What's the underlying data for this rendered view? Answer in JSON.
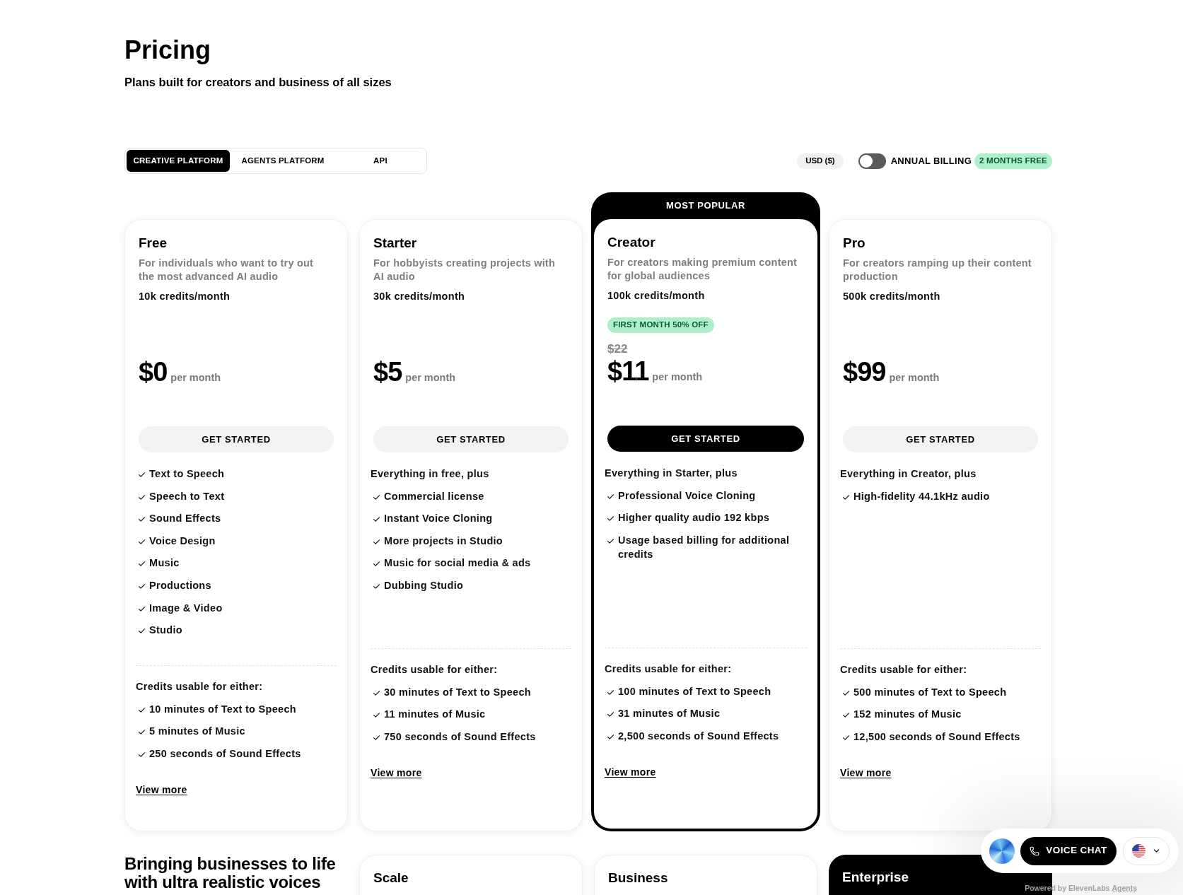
{
  "header": {
    "title": "Pricing",
    "subtitle": "Plans built for creators and business of all sizes"
  },
  "tabs": [
    {
      "label": "CREATIVE PLATFORM",
      "selected": true
    },
    {
      "label": "AGENTS PLATFORM",
      "selected": false
    },
    {
      "label": "API",
      "selected": false
    }
  ],
  "currency": "USD ($)",
  "billing": {
    "label": "ANNUAL BILLING",
    "on": false,
    "badge": "2 MONTHS FREE"
  },
  "plans": [
    {
      "name": "Free",
      "featured": false,
      "description": "For individuals who want to try out the most advanced AI audio",
      "credits": "10k credits/month",
      "price": "$0",
      "period": "per month",
      "cta": "GET STARTED",
      "features": [
        "Text to Speech",
        "Speech to Text",
        "Sound Effects",
        "Voice Design",
        "Music",
        "Productions",
        "Image & Video",
        "Studio"
      ],
      "credits_heading": "Credits usable for either:",
      "credit_uses": [
        "10 minutes of Text to Speech",
        "5 minutes of Music",
        "250 seconds of Sound Effects"
      ],
      "link": "View more"
    },
    {
      "name": "Starter",
      "featured": false,
      "description": "For hobbyists creating projects with AI audio",
      "credits": "30k credits/month",
      "price": "$5",
      "period": "per month",
      "cta": "GET STARTED",
      "features_intro": "Everything in free, plus",
      "features": [
        "Commercial license",
        "Instant Voice Cloning",
        "More projects in Studio",
        "Music for social media & ads",
        "Dubbing Studio"
      ],
      "credits_heading": "Credits usable for either:",
      "credit_uses": [
        "30 minutes of Text to Speech",
        "11 minutes of Music",
        "750 seconds of Sound Effects"
      ],
      "link": "View more"
    },
    {
      "name": "Creator",
      "featured": true,
      "ribbon": "MOST POPULAR",
      "description": "For creators making premium content for global audiences",
      "credits": "100k credits/month",
      "promo": "FIRST MONTH 50% OFF",
      "original_price": "$22",
      "price": "$11",
      "period": "per month",
      "cta": "GET STARTED",
      "features_intro": "Everything in Starter, plus",
      "features": [
        "Professional Voice Cloning",
        "Higher quality audio 192 kbps",
        "Usage based billing for additional credits"
      ],
      "credits_heading": "Credits usable for either:",
      "credit_uses": [
        "100 minutes of Text to Speech",
        "31 minutes of Music",
        "2,500 seconds of Sound Effects"
      ],
      "link": "View more"
    },
    {
      "name": "Pro",
      "featured": false,
      "description": "For creators ramping up their content production",
      "credits": "500k credits/month",
      "price": "$99",
      "period": "per month",
      "cta": "GET STARTED",
      "features_intro": "Everything in Creator, plus",
      "features": [
        "High-fidelity 44.1kHz audio"
      ],
      "credits_heading": "Credits usable for either:",
      "credit_uses": [
        "500 minutes of Text to Speech",
        "152 minutes of Music",
        "12,500 seconds of Sound Effects"
      ],
      "link": "View more"
    }
  ],
  "enterprise_section": {
    "heading": "Bringing businesses to life with ultra realistic voices",
    "plans": [
      {
        "name": "Scale",
        "dark": false
      },
      {
        "name": "Business",
        "dark": false
      },
      {
        "name": "Enterprise",
        "dark": true
      }
    ]
  },
  "voice_widget": {
    "button": "VOICE CHAT",
    "powered_by": "Powered by ElevenLabs",
    "powered_by_link": "Agents"
  }
}
